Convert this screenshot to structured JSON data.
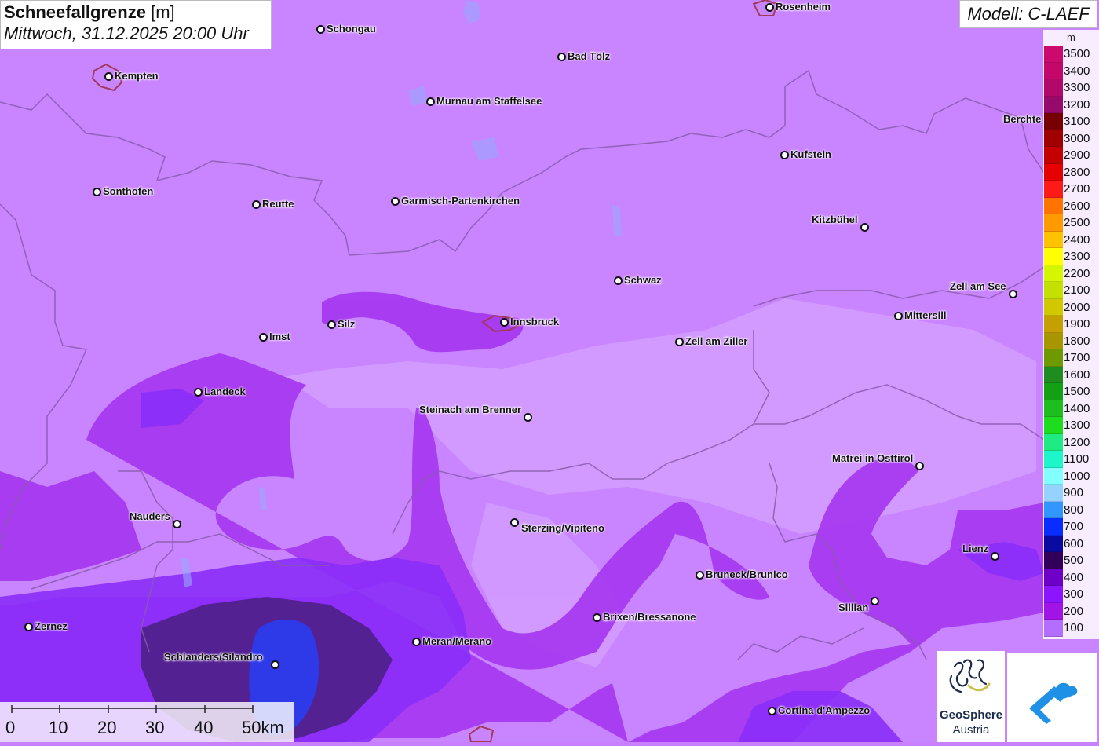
{
  "header": {
    "title_bold": "Schneefallgrenze",
    "title_unit": "[m]",
    "datetime": "Mittwoch, 31.12.2025 20:00 Uhr",
    "model": "Modell: C-LAEF"
  },
  "legend": {
    "unit": "m",
    "items": [
      {
        "label": "3500",
        "color": "#cc0a6e"
      },
      {
        "label": "3400",
        "color": "#c4086a"
      },
      {
        "label": "3300",
        "color": "#b2086a"
      },
      {
        "label": "3200",
        "color": "#950a6a"
      },
      {
        "label": "3100",
        "color": "#760000"
      },
      {
        "label": "3000",
        "color": "#a00000"
      },
      {
        "label": "2900",
        "color": "#c40000"
      },
      {
        "label": "2800",
        "color": "#e60000"
      },
      {
        "label": "2700",
        "color": "#ff1a1a"
      },
      {
        "label": "2600",
        "color": "#ff7300"
      },
      {
        "label": "2500",
        "color": "#ff9a00"
      },
      {
        "label": "2400",
        "color": "#ffc200"
      },
      {
        "label": "2300",
        "color": "#ffff00"
      },
      {
        "label": "2200",
        "color": "#d6f500"
      },
      {
        "label": "2100",
        "color": "#c4e000"
      },
      {
        "label": "2000",
        "color": "#d2c800"
      },
      {
        "label": "1900",
        "color": "#c4a000"
      },
      {
        "label": "1800",
        "color": "#a89600"
      },
      {
        "label": "1700",
        "color": "#6e9a00"
      },
      {
        "label": "1600",
        "color": "#1e8c1e"
      },
      {
        "label": "1500",
        "color": "#14a014"
      },
      {
        "label": "1400",
        "color": "#1ebe1e"
      },
      {
        "label": "1300",
        "color": "#1edc1e"
      },
      {
        "label": "1200",
        "color": "#1eeb82"
      },
      {
        "label": "1100",
        "color": "#1ef5c8"
      },
      {
        "label": "1000",
        "color": "#82ffff"
      },
      {
        "label": "900",
        "color": "#96d2ff"
      },
      {
        "label": "800",
        "color": "#3296ff"
      },
      {
        "label": "700",
        "color": "#0a2dff"
      },
      {
        "label": "600",
        "color": "#0a0aa0"
      },
      {
        "label": "500",
        "color": "#32005a"
      },
      {
        "label": "400",
        "color": "#6e00c8"
      },
      {
        "label": "300",
        "color": "#8c14ff"
      },
      {
        "label": "200",
        "color": "#a014e6"
      },
      {
        "label": "100",
        "color": "#b46eff"
      }
    ]
  },
  "cities": [
    {
      "name": "Rosenheim"
    },
    {
      "name": "Schongau"
    },
    {
      "name": "Kempten"
    },
    {
      "name": "Bad Tölz"
    },
    {
      "name": "Murnau am Staffelsee"
    },
    {
      "name": "Berchte"
    },
    {
      "name": "Kufstein"
    },
    {
      "name": "Sonthofen"
    },
    {
      "name": "Reutte"
    },
    {
      "name": "Garmisch-Partenkirchen"
    },
    {
      "name": "Kitzbühel"
    },
    {
      "name": "Schwaz"
    },
    {
      "name": "Zell am See"
    },
    {
      "name": "Mittersill"
    },
    {
      "name": "Innsbruck"
    },
    {
      "name": "Silz"
    },
    {
      "name": "Imst"
    },
    {
      "name": "Zell am Ziller"
    },
    {
      "name": "Landeck"
    },
    {
      "name": "Steinach am Brenner"
    },
    {
      "name": "Matrei in Osttirol"
    },
    {
      "name": "Nauders"
    },
    {
      "name": "Sterzing/Vipiteno"
    },
    {
      "name": "Lienz"
    },
    {
      "name": "Bruneck/Brunico"
    },
    {
      "name": "Sillian"
    },
    {
      "name": "Brixen/Bressanone"
    },
    {
      "name": "Zernez"
    },
    {
      "name": "Meran/Merano"
    },
    {
      "name": "Schlanders/Silandro"
    },
    {
      "name": "Cortina d'Ampezzo"
    }
  ],
  "scale_bar": {
    "labels": [
      "0",
      "10",
      "20",
      "30",
      "40",
      "50km"
    ]
  },
  "logos": {
    "geosphere_name": "GeoSphere",
    "geosphere_sub": "Austria"
  },
  "colors": {
    "base_field": "#c880ff",
    "field_200": "#a62ef0",
    "field_300": "#8c2cff",
    "field_500": "#4a1a7a",
    "field_700": "#2a3cf0"
  }
}
